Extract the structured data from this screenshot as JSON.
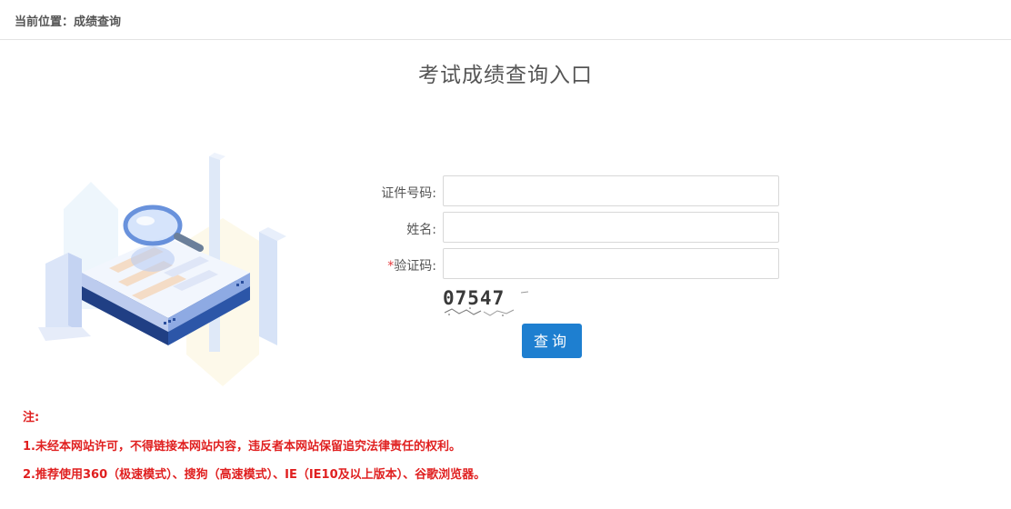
{
  "breadcrumb": {
    "text": "当前位置：成绩查询"
  },
  "title": "考试成绩查询入口",
  "form": {
    "id_label": "证件号码:",
    "id_value": "",
    "name_label": "姓名:",
    "name_value": "",
    "captcha_required_mark": "*",
    "captcha_label": "验证码:",
    "captcha_value": "",
    "captcha_image_text": "07547",
    "submit_label": "查询"
  },
  "notes": {
    "heading": "注:",
    "items": [
      "1.未经本网站许可，不得链接本网站内容，违反者本网站保留追究法律责任的权利。",
      "2.推荐使用360（极速模式）、搜狗（高速模式）、IE（IE10及以上版本）、谷歌浏览器。"
    ]
  },
  "colors": {
    "accent": "#1e7fd0",
    "notice": "#e02020",
    "required": "#e4393c"
  },
  "icons": {
    "illustration": "magnifier-over-document-icon"
  }
}
